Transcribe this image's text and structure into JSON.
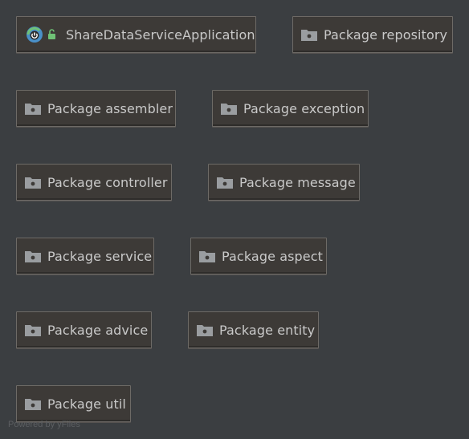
{
  "diagram": {
    "nodes": [
      {
        "id": "app",
        "label": "ShareDataServiceApplication",
        "icon": "spring-boot-app-icon"
      },
      {
        "id": "repository",
        "label": "Package repository",
        "icon": "folder-icon"
      },
      {
        "id": "assembler",
        "label": "Package assembler",
        "icon": "folder-icon"
      },
      {
        "id": "exception",
        "label": "Package exception",
        "icon": "folder-icon"
      },
      {
        "id": "controller",
        "label": "Package controller",
        "icon": "folder-icon"
      },
      {
        "id": "message",
        "label": "Package message",
        "icon": "folder-icon"
      },
      {
        "id": "service",
        "label": "Package service",
        "icon": "folder-icon"
      },
      {
        "id": "aspect",
        "label": "Package aspect",
        "icon": "folder-icon"
      },
      {
        "id": "advice",
        "label": "Package advice",
        "icon": "folder-icon"
      },
      {
        "id": "entity",
        "label": "Package entity",
        "icon": "folder-icon"
      },
      {
        "id": "util",
        "label": "Package util",
        "icon": "folder-icon"
      }
    ]
  },
  "footer": {
    "watermark": "Powered by yFiles"
  },
  "colors": {
    "background": "#3b3e41",
    "node_fill": "#3d3a37",
    "node_border": "#6d6a66",
    "label_text": "#c9c9c9",
    "folder_icon": "#9a9da0"
  }
}
